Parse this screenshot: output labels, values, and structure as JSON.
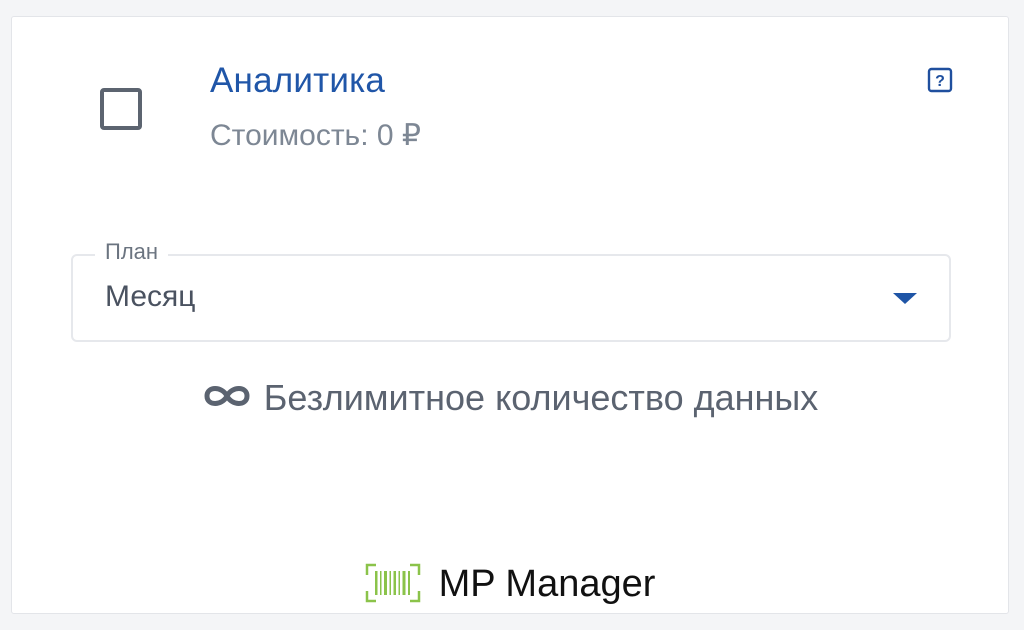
{
  "service": {
    "title": "Аналитика",
    "cost_label": "Стоимость: 0 ₽",
    "help_icon": "question-square-icon",
    "checked": false
  },
  "plan_select": {
    "label": "План",
    "value": "Месяц",
    "arrow_icon": "dropdown-arrow-icon"
  },
  "feature": {
    "icon": "infinity-icon",
    "text": "Безлимитное количество данных"
  },
  "footer": {
    "logo_icon": "barcode-icon",
    "brand": "MP Manager"
  },
  "colors": {
    "accent": "#2056a8",
    "logo": "#8bc34a",
    "muted_text": "#7d8794"
  }
}
